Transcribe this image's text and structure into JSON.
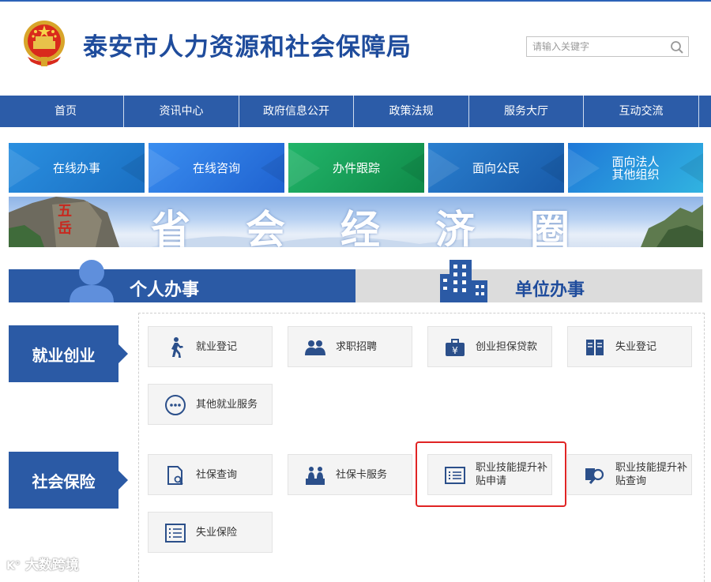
{
  "header": {
    "title": "泰安市人力资源和社会保障局",
    "search_placeholder": "请输入关键字"
  },
  "nav": {
    "items": [
      "首页",
      "资讯中心",
      "政府信息公开",
      "政策法规",
      "服务大厅",
      "互动交流"
    ]
  },
  "quick_tiles": [
    {
      "label": "在线办事",
      "color": "#1f7fd0"
    },
    {
      "label": "在线咨询",
      "color": "#2d7fe0"
    },
    {
      "label": "办件跟踪",
      "color": "#18a35a"
    },
    {
      "label": "面向公民",
      "color": "#1e6fc0"
    },
    {
      "label": "面向法人\n其他组织",
      "color": "#28a0d8"
    }
  ],
  "banner": {
    "chars": [
      "省",
      "会",
      "经",
      "济",
      "圈"
    ],
    "rock_text": "五岳"
  },
  "tabs": {
    "personal": "个人办事",
    "unit": "单位办事"
  },
  "categories": {
    "employment": {
      "label": "就业创业",
      "services": [
        "就业登记",
        "求职招聘",
        "创业担保贷款",
        "失业登记",
        "其他就业服务"
      ]
    },
    "insurance": {
      "label": "社会保险",
      "services": [
        "社保查询",
        "社保卡服务",
        "职业技能提升补贴申请",
        "职业技能提升补贴查询",
        "失业保险"
      ]
    }
  },
  "watermark": {
    "logo": "K°",
    "text": "大数跨境"
  },
  "colors": {
    "primary": "#2b5aa5",
    "title": "#1f4c9c",
    "highlight": "#e02424"
  }
}
